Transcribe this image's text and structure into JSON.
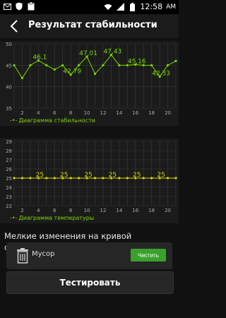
{
  "statusbar": {
    "time": "12:58",
    "ampm": "AM",
    "icons": [
      "email-icon",
      "shield-icon",
      "clipboard-icon",
      "wifi-icon",
      "signal-icon",
      "battery-icon"
    ]
  },
  "header": {
    "title": "Результат стабильности"
  },
  "stability_chart": {
    "legend": "Диаграмма стабильности",
    "line_color": "#7cd600"
  },
  "temperature_chart": {
    "legend": "Диаграмма температуры",
    "line_color": "#d6d600"
  },
  "info_text": "Мелкие изменения на кривой отображают лучшую стабильность",
  "trash": {
    "label": "Мусор",
    "button": "Чистить"
  },
  "test_button": "Тестировать",
  "colors": {
    "accent": "#7cd600",
    "temp": "#d6d600",
    "button": "#3aa22c"
  },
  "chart_data": [
    {
      "type": "line",
      "x": [
        1,
        2,
        3,
        4,
        5,
        6,
        7,
        8,
        9,
        10,
        11,
        12,
        13,
        14,
        15,
        16,
        17,
        18,
        19,
        20,
        21
      ],
      "values": [
        45,
        42,
        45,
        46.1,
        45,
        44,
        45,
        42.79,
        45,
        47.01,
        43,
        45,
        47.43,
        45,
        45,
        45.16,
        45,
        45,
        42.33,
        45,
        46
      ],
      "ylim": [
        35,
        50
      ],
      "yticks": [
        35,
        40,
        45,
        50
      ],
      "xticks": [
        2,
        4,
        6,
        8,
        10,
        12,
        14,
        16,
        18,
        20
      ],
      "labels": [
        {
          "x": 4,
          "text": "46,1"
        },
        {
          "x": 8,
          "text": "42,79"
        },
        {
          "x": 10,
          "text": "47,01"
        },
        {
          "x": 13,
          "text": "47,43"
        },
        {
          "x": 16,
          "text": "45,16"
        },
        {
          "x": 19,
          "text": "42,33"
        }
      ],
      "grid": true,
      "legend": "Диаграмма стабильности"
    },
    {
      "type": "line",
      "x": [
        1,
        2,
        3,
        4,
        5,
        6,
        7,
        8,
        9,
        10,
        11,
        12,
        13,
        14,
        15,
        16,
        17,
        18,
        19,
        20,
        21
      ],
      "values": [
        25,
        25,
        25,
        25,
        25,
        25,
        25,
        25,
        25,
        25,
        25,
        25,
        25,
        25,
        25,
        25,
        25,
        25,
        25,
        25,
        25
      ],
      "ylim": [
        22,
        29
      ],
      "yticks": [
        22,
        23,
        24,
        25,
        26,
        27,
        28,
        29
      ],
      "xticks": [
        2,
        4,
        6,
        8,
        10,
        12,
        14,
        16,
        18,
        20
      ],
      "labels": [
        {
          "x": 4,
          "text": "25"
        },
        {
          "x": 7,
          "text": "25"
        },
        {
          "x": 10,
          "text": "25"
        },
        {
          "x": 13,
          "text": "25"
        },
        {
          "x": 16,
          "text": "25"
        },
        {
          "x": 19,
          "text": "25"
        }
      ],
      "grid": true,
      "legend": "Диаграмма температуры"
    }
  ]
}
